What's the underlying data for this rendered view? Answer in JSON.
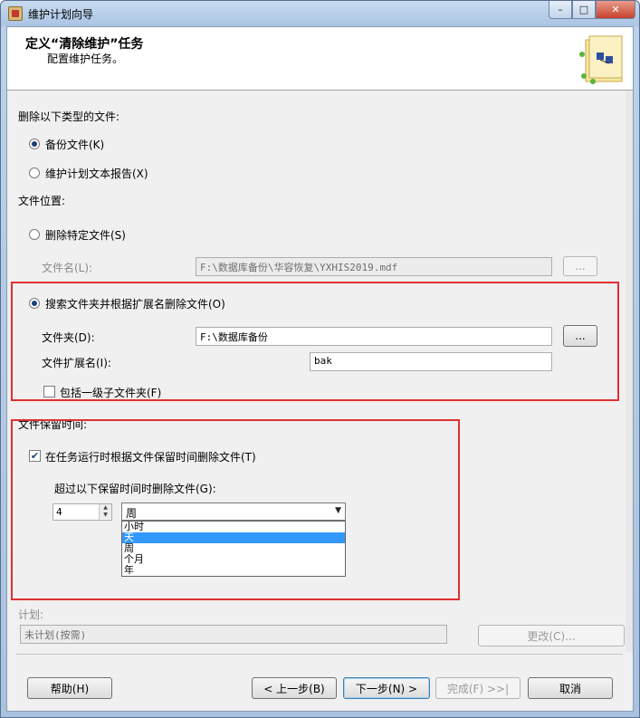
{
  "window": {
    "title": "维护计划向导",
    "controls": {
      "minimize": "–",
      "maximize": "□",
      "close": "✕"
    }
  },
  "header": {
    "title": "定义“清除维护”任务",
    "subtitle": "配置维护任务。"
  },
  "delete_type": {
    "label": "删除以下类型的文件:",
    "options": [
      {
        "label": "备份文件(K)",
        "selected": true
      },
      {
        "label": "维护计划文本报告(X)",
        "selected": false
      }
    ]
  },
  "location": {
    "label": "文件位置:",
    "specific": {
      "label": "删除特定文件(S)",
      "selected": false,
      "file_name_label": "文件名(L):",
      "file_name_value": "F:\\数据库备份\\华容恢复\\YXHIS2019.mdf",
      "browse": "..."
    },
    "search": {
      "label": "搜索文件夹并根据扩展名删除文件(O)",
      "selected": true,
      "folder_label": "文件夹(D):",
      "folder_value": "F:\\数据库备份",
      "browse": "...",
      "ext_label": "文件扩展名(I):",
      "ext_value": "bak",
      "include_sub_label": "包括一级子文件夹(F)",
      "include_sub_checked": false
    }
  },
  "retention": {
    "label": "文件保留时间:",
    "delete_on_run_label": "在任务运行时根据文件保留时间删除文件(T)",
    "delete_on_run_checked": true,
    "older_than_label": "超过以下保留时间时删除文件(G):",
    "amount": "4",
    "unit_selected": "周",
    "unit_options": [
      "小时",
      "天",
      "周",
      "个月",
      "年"
    ],
    "highlighted_option": "天"
  },
  "schedule": {
    "label": "计划:",
    "value": "未计划(按需)",
    "change_button": "更改(C)..."
  },
  "footer": {
    "help": "帮助(H)",
    "back": "< 上一步(B)",
    "next": "下一步(N) >",
    "finish": "完成(F) >>|",
    "cancel": "取消"
  },
  "colors": {
    "highlight_box": "#e03030",
    "selection": "#3399ff"
  }
}
